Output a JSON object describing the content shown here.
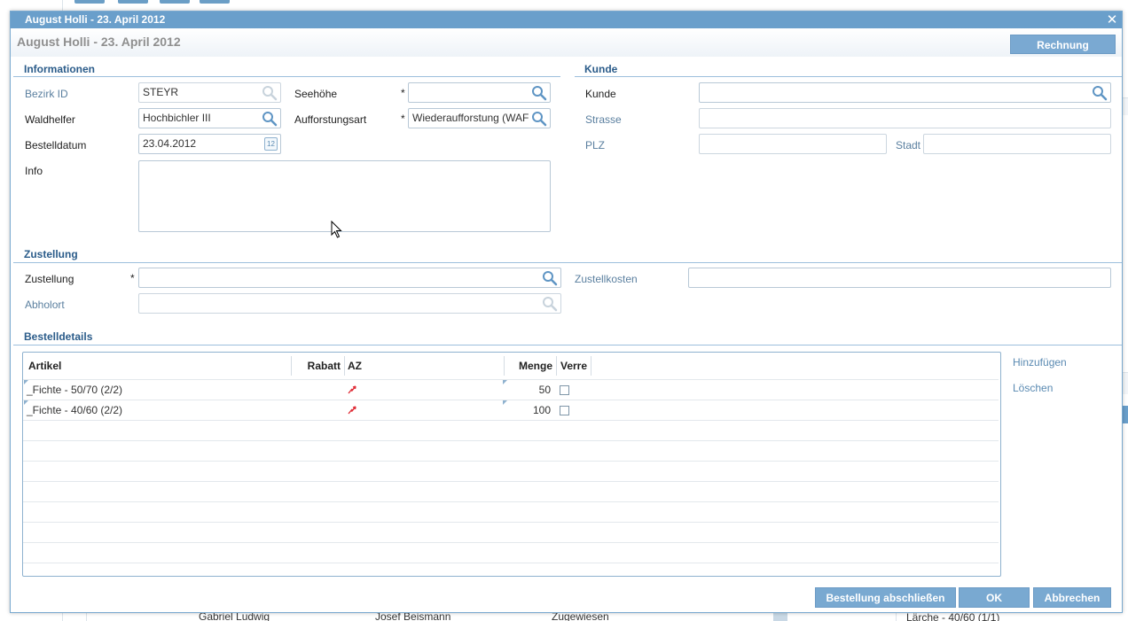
{
  "background": {
    "row_cells": [
      "Gabriel Ludwig",
      "Josef Beismann",
      "Zugewiesen",
      "Lärche - 40/60 (1/1)"
    ]
  },
  "dialog": {
    "title": "August Holli - 23. April 2012",
    "subtitle": "August Holli - 23. April 2012",
    "print_button": "Rechnung drucken...",
    "close_glyph": "✕"
  },
  "informationen": {
    "section_title": "Informationen",
    "bezirk_label": "Bezirk ID",
    "bezirk_value": "STEYR",
    "waldhelfer_label": "Waldhelfer",
    "waldhelfer_value": "Hochbichler III",
    "bestelldatum_label": "Bestelldatum",
    "bestelldatum_value": "23.04.2012",
    "info_label": "Info",
    "info_value": "",
    "seehoehe_label": "Seehöhe",
    "seehoehe_value": "",
    "aufforstungsart_label": "Aufforstungsart",
    "aufforstungsart_value": "Wiederaufforstung (WAF",
    "required_mark": "*",
    "calendar_glyph": "12"
  },
  "kunde": {
    "section_title": "Kunde",
    "kunde_label": "Kunde",
    "kunde_value": "",
    "strasse_label": "Strasse",
    "strasse_value": "",
    "plz_label": "PLZ",
    "plz_value": "",
    "stadt_label": "Stadt",
    "stadt_value": ""
  },
  "zustellung": {
    "section_title": "Zustellung",
    "zustellung_label": "Zustellung",
    "zustellung_value": "",
    "abholort_label": "Abholort",
    "abholort_value": "",
    "zustellkosten_label": "Zustellkosten",
    "zustellkosten_value": "",
    "required_mark": "*"
  },
  "bestelldetails": {
    "section_title": "Bestelldetails",
    "columns": [
      "Artikel",
      "Rabatt",
      "AZ",
      "Menge",
      "Verre"
    ],
    "rows": [
      {
        "artikel": "_Fichte - 50/70 (2/2)",
        "rabatt": "",
        "az_icon": "red-flag-icon",
        "menge": "50",
        "verrechnet": false
      },
      {
        "artikel": "_Fichte - 40/60 (2/2)",
        "rabatt": "",
        "az_icon": "red-flag-icon",
        "menge": "100",
        "verrechnet": false
      }
    ],
    "add_link": "Hinzufügen",
    "delete_link": "Löschen"
  },
  "footer": {
    "finish_button": "Bestellung abschließen",
    "ok_button": "OK",
    "cancel_button": "Abbrechen"
  },
  "colors": {
    "titlebar": "#6a9fcb",
    "section_title": "#2b5c8a",
    "button": "#79a9d1",
    "az_flag": "#e0303a"
  }
}
